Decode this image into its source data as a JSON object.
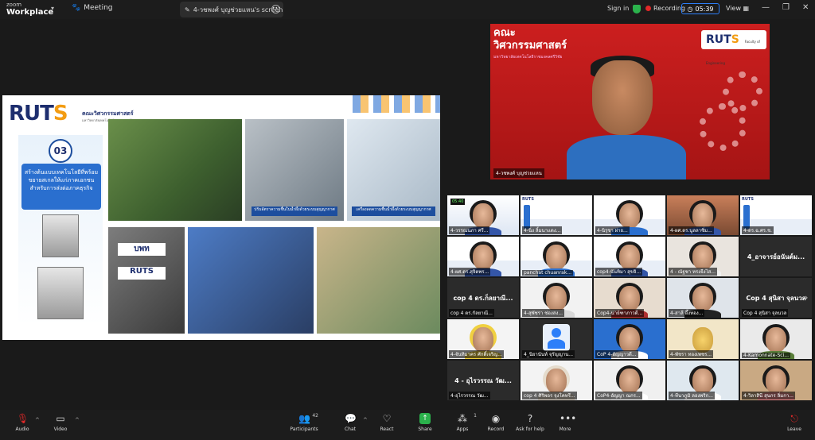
{
  "titlebar": {
    "brand_small": "zoom",
    "brand_big": "Workplace",
    "meeting_label": "Meeting",
    "share_tab_label": "4-วชพงศ์ บุญช่วยแหน's screen",
    "signin_label": "Sign in",
    "recording_label": "Recording",
    "timer": "05:39",
    "view_label": "View"
  },
  "slide": {
    "logo_main": "RUT",
    "logo_accent": "S",
    "faculty": "คณะวิศวกรรมศาสตร์",
    "subfaculty": "มหาวิทยาลัยเทคโนโลยีราชมงคลศรีวิชัย",
    "number": "03",
    "banner_text": "สร้างต้นแบบเทคโนโลยีที่พร้อมขยายสเกลให้แก่ภาคเอกชน สำหรับการส่งต่อภาคธุรกิจ",
    "label_b": "ปรับอัตราความชื้นในน้ำผึ้งด้วยระบบสุญญากาศ",
    "label_c": "เครื่องลดความชื้นน้ำผึ้งด้วยระบบสุญญากาศ",
    "machine_text_1": "บพท",
    "machine_text_2": "RUTS"
  },
  "speaker": {
    "bg_title_1": "คณะ",
    "bg_title_2": "วิศวกรรมศาสตร์",
    "bg_sub": "มหาวิทยาลัยเทคโนโลยีราชมงคลศรีวิชัย",
    "logo_main": "RUT",
    "logo_accent": "S",
    "logo_caption": "Faculty of Engineering",
    "name": "4-วชพงศ์ บุญช่วยแหน"
  },
  "gallery": {
    "timer_badge": "05:40",
    "row1": [
      "4-วรรณนภา ศรี...",
      "4-นิ่ง ลิ้มนาแดง...",
      "4-นิรุชา ผ่าย...",
      "4-ผศ.ดร.นูลลาซิ่ม...",
      "4-ดร.ฉ.ศร.ช."
    ],
    "row2": [
      "4-ผศ.ดร.สุจิตพร...",
      "panchat chuanrak...",
      "cop4-นันทิมา สุขจิ...",
      "4 - ณัฐชา หรงจีงไส...",
      "4_อาจารย์อนันต์ม..."
    ],
    "row2_bigname": "4_อาจารย์อนันต์ม...",
    "row3_bigname_left": "cop 4 ดร.ก็ลยาณี...",
    "row3": [
      "cop 4 ดร.กัลยาณี...",
      "4-สุพัชรา ช่องสง...",
      "Cop4-นาย์ฑาภาวดี...",
      "4-สาลี อึ้งทอง...",
      "Cop 4 สุนิสา จุลนวล"
    ],
    "row3_bigname_right": "Cop 4 สุนิสา จุลนวล",
    "row4": [
      "4-จันทิมาคร ศักดิ์เจริญ...",
      "4_นิยานันท์ จุรัญญาน...",
      "CoP 4-อัญญาวดี...",
      "4-พัชรา ทองเพชร...",
      "4-Kamonnate-Sci..."
    ],
    "row5": [
      "4-อุไรวรรณ วัฒ...",
      "cop 4 ศิริพอร จุงโคทรี...",
      "CoP4-อัญญา ณกร...",
      "4-ทีนาภูมิ ลองพริก...",
      "4-วิลาสินี สุนกร ลิ่มกา..."
    ],
    "row5_bigname": "4 - อุไรวรรณ วัฒ..."
  },
  "toolbar": {
    "audio": "Audio",
    "video": "Video",
    "participants": "Participants",
    "participants_count": "42",
    "chat": "Chat",
    "react": "React",
    "share": "Share",
    "apps": "Apps",
    "apps_count": "1",
    "record": "Record",
    "help": "Ask for help",
    "more": "More",
    "leave": "Leave"
  },
  "colors": {
    "accent": "#2d7ff9",
    "recording": "#e02828",
    "share": "#2bb24c",
    "slide_brand": "#1d2e6e",
    "slide_accent": "#f39c12",
    "speaker_bg": "#cc1f1f"
  }
}
